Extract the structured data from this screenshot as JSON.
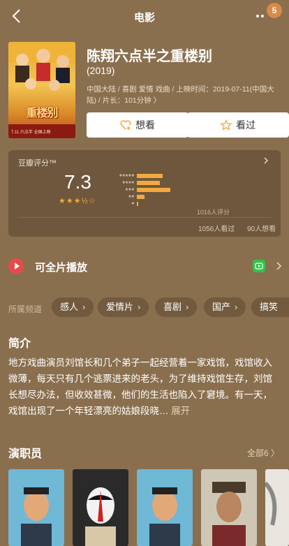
{
  "header": {
    "title": "电影",
    "badge": "5",
    "back_icon": "back-arrow-icon",
    "more_icon": "more-dots-icon"
  },
  "movie": {
    "poster_title": "重楼别",
    "poster_date": "7.11 六点半 全国上映",
    "title": "陈翔六点半之重楼别",
    "year": "(2019)",
    "meta": "中国大陆 / 喜剧 爱情 戏曲 / 上映时间：2019-07-11(中国大陆) / 片长：101分钟 〉"
  },
  "actions": {
    "want": "想看",
    "seen": "看过"
  },
  "rating": {
    "label": "豆瓣评分™",
    "score": "7.3",
    "stars_display": "★★★½☆",
    "star_labels": [
      "★★★★★",
      "★★★★",
      "★★★",
      "★★",
      "★"
    ],
    "distribution": [
      0.2,
      0.18,
      0.26,
      0.06,
      0.01
    ],
    "count": "1016人评分",
    "seen": "1056人看过",
    "want": "90人想看"
  },
  "play": {
    "label": "可全片播放",
    "source_icon": "iqiyi-icon"
  },
  "channels": {
    "label": "所属频道",
    "items": [
      "感人",
      "爱情片",
      "喜剧",
      "国产",
      "搞笑"
    ]
  },
  "synopsis": {
    "title": "简介",
    "text": "地方戏曲演员刘馆长和几个弟子一起经营着一家戏馆，戏馆收入微薄，每天只有几个逃票进来的老头，为了维持戏馆生存，刘馆长想尽办法，但收效甚微，他们的生活也陷入了窘境。有一天，戏馆出现了一个年轻漂亮的姑娘段晓…",
    "more": "展开"
  },
  "cast": {
    "title": "演职员",
    "all": "全部6 〉"
  },
  "colors": {
    "background": "#8a6f4e",
    "accent_star": "#f3a93e",
    "play_red": "#e84a4a",
    "source_green": "#2fc448"
  }
}
